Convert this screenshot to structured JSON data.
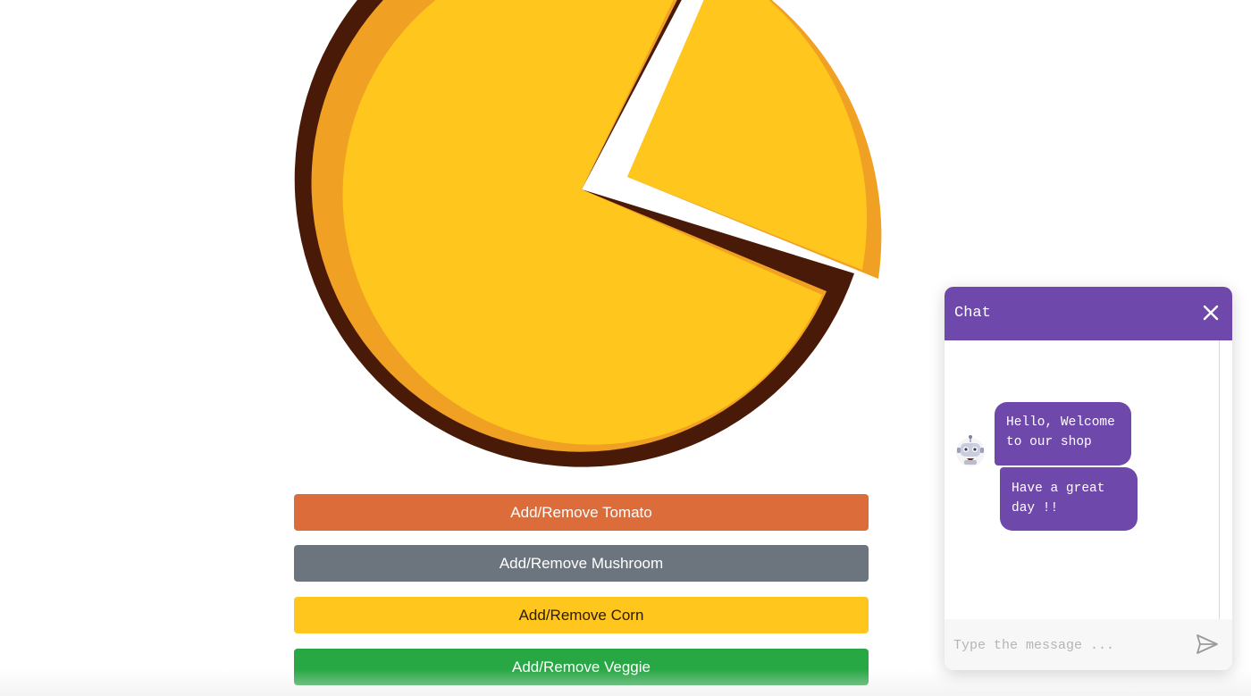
{
  "buttons": {
    "tomato_label": "Add/Remove Tomato",
    "mushroom_label": "Add/Remove Mushroom",
    "corn_label": "Add/Remove Corn",
    "veggie_label": "Add/Remove Veggie"
  },
  "chat": {
    "title": "Chat",
    "messages": [
      {
        "text": "Hello, Welcome to our shop"
      },
      {
        "text": "Have a great day !!"
      }
    ],
    "input_placeholder": "Type the message ..."
  },
  "icons": {
    "close": "close-icon",
    "send": "send-icon",
    "avatar": "robot-icon"
  },
  "colors": {
    "crust": "#4a1a08",
    "sauce": "#f0a022",
    "cheese": "#ffc61e",
    "tomato": "#dc6d3a",
    "mushroom": "#6c757d",
    "corn": "#ffc61e",
    "veggie": "#28a745",
    "chat_accent": "#6f48ab"
  }
}
